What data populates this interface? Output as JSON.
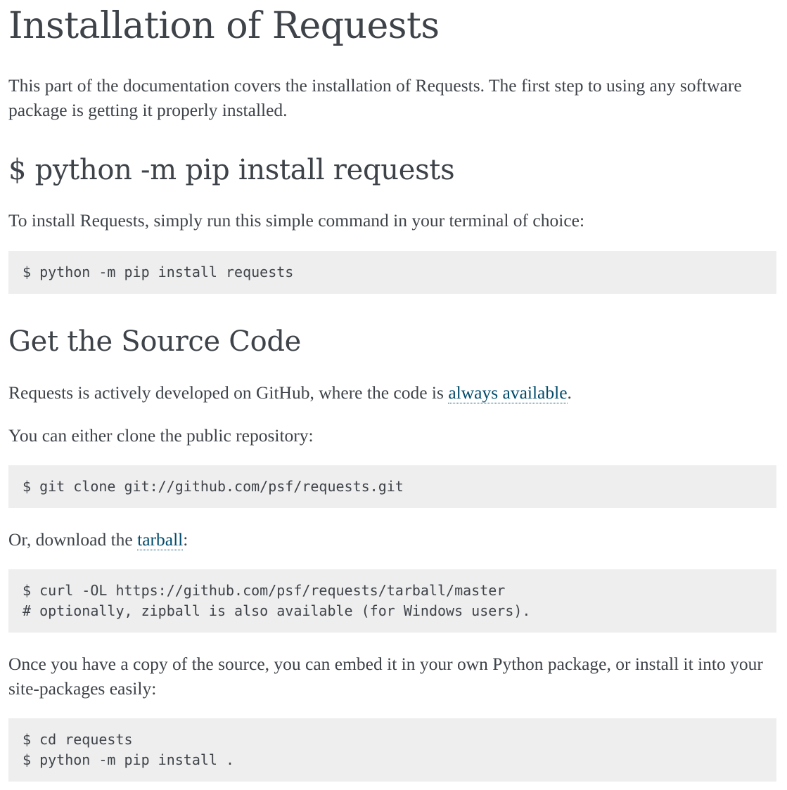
{
  "title": "Installation of Requests",
  "intro": "This part of the documentation covers the installation of Requests. The first step to using any software package is getting it properly installed.",
  "pip_section": {
    "heading": "$ python -m pip install requests",
    "text": "To install Requests, simply run this simple command in your terminal of choice:",
    "code": [
      "$ python -m pip install requests"
    ]
  },
  "source_section": {
    "heading": "Get the Source Code",
    "text_before_link": "Requests is actively developed on GitHub, where the code is ",
    "link_always_available": "always available",
    "text_after_link": ".",
    "clone_text": "You can either clone the public repository:",
    "clone_code": [
      "$ git clone git://github.com/psf/requests.git"
    ],
    "download_before_link": "Or, download the ",
    "link_tarball": "tarball",
    "download_after_link": ":",
    "download_code": [
      "$ curl -OL https://github.com/psf/requests/tarball/master",
      "# optionally, zipball is also available (for Windows users)."
    ],
    "embed_text": "Once you have a copy of the source, you can embed it in your own Python package, or install it into your site-packages easily:",
    "install_code": [
      "$ cd requests",
      "$ python -m pip install ."
    ]
  }
}
